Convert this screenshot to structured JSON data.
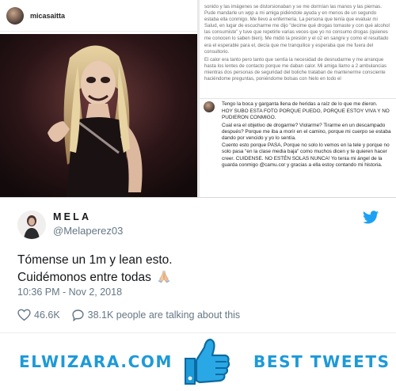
{
  "instagram": {
    "username": "micasaitta"
  },
  "story_text": {
    "paragraphs": [
      "sonido y las imágenes se distorsionaban y se me dormían las manos y las piernas. Pude mandarle un wpp a mi amiga pidiéndole ayuda y en menos de un segundo estaba ella conmigo. Me llevo a enfermeria. La persona que tenía que evaluar mi Salud, en lugar de escucharme me dijo \"decime qué drogas tomaste y con qué alcohol las consumiste\" y tuve que repetirle varias veces que yo no consumo drogas (quienes me conocen lo saben bien). Me midió la presión y el o2 en sangre y como el resultado era el esperable para el, decía que me tranquilice y esperaba que me fuera del consultorio.",
      "El calor era tanto pero tanto que sentía la necesidad de desnudarme y me arranque hasta los lentes de contacto porque me daban calor. Mi amiga llamo a 2 ambulancias mientras dos personas de seguridad del boliche trataban de mantenerme consciente haciéndome preguntas, poniéndome bolsas con hielo en todo el"
    ]
  },
  "comment": {
    "lines": [
      "Tengo la boca y garganta llena de heridas a raíz de lo que me dieron.",
      "HOY SUBO ESTA FOTO PORQUE PUEDO, PORQUE ESTOY VIVA Y NO PUDIERON CONMIGO.",
      "Cual era el objetivo de drogarme? Violarme? Tirarme en un descampado después? Porque me iba a morir en el camino, porque mi cuerpo se estaba dando por vencido y yo lo sentía.",
      "Cuento esto porque PASA, Porque no solo lo vemos en la tele y porque no solo pasa \"en la clase media baja\" como muchos dicen y te quieren hacer creer. CUIDENSE. NO ESTÉN SOLAS NUNCA! Yo tenia mi ángel de la guarda conmigo @camu.cor y gracias a ella estoy contando mi historia."
    ]
  },
  "tweet": {
    "display_name": "MELA",
    "handle": "@Melaperez03",
    "text_line1": "Tómense un 1m y lean esto.",
    "text_line2": "Cuidémonos entre todas",
    "emoji": "folded-hands",
    "timestamp": "10:36 PM - Nov 2, 2018",
    "likes": "46.6K",
    "talking": "38.1K people are talking about this"
  },
  "banner": {
    "left_text": "ELWIZARA.COM",
    "right_text": "BEST TWEETS"
  },
  "colors": {
    "brand_blue": "#1d9ad8",
    "twitter_blue": "#1da1f2",
    "text_dark": "#14171a",
    "text_muted": "#657786"
  }
}
